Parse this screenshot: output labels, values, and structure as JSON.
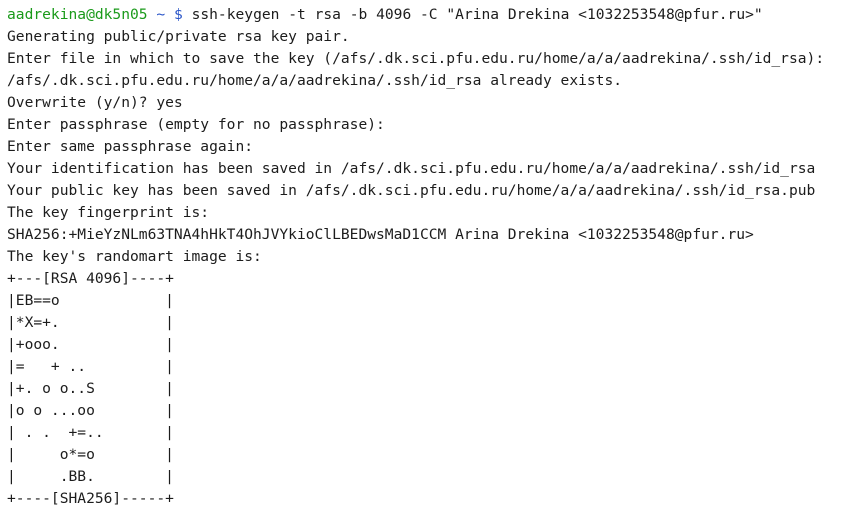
{
  "prompt": {
    "user_host": "aadrekina@dk5n05",
    "path": "~",
    "symbol": "$",
    "command": "ssh-keygen -t rsa -b 4096 -C \"Arina Drekina <1032253548@pfur.ru>\""
  },
  "output_lines": [
    "Generating public/private rsa key pair.",
    "Enter file in which to save the key (/afs/.dk.sci.pfu.edu.ru/home/a/a/aadrekina/.ssh/id_rsa):",
    "/afs/.dk.sci.pfu.edu.ru/home/a/a/aadrekina/.ssh/id_rsa already exists.",
    "Overwrite (y/n)? yes",
    "Enter passphrase (empty for no passphrase):",
    "Enter same passphrase again:",
    "Your identification has been saved in /afs/.dk.sci.pfu.edu.ru/home/a/a/aadrekina/.ssh/id_rsa",
    "Your public key has been saved in /afs/.dk.sci.pfu.edu.ru/home/a/a/aadrekina/.ssh/id_rsa.pub",
    "The key fingerprint is:",
    "SHA256:+MieYzNLm63TNA4hHkT4OhJVYkioClLBEDwsMaD1CCM Arina Drekina <1032253548@pfur.ru>",
    "The key's randomart image is:",
    "+---[RSA 4096]----+",
    "|EB==o            |",
    "|*X=+.            |",
    "|+ooo.            |",
    "|=   + ..         |",
    "|+. o o..S        |",
    "|o o ...oo        |",
    "| . .  +=..       |",
    "|     o*=o        |",
    "|     .BB.        |",
    "+----[SHA256]-----+"
  ],
  "colors": {
    "background": "#ffffff",
    "text": "#1c1c1c",
    "prompt_user": "#1a9a1a",
    "prompt_path": "#2a55c8"
  }
}
